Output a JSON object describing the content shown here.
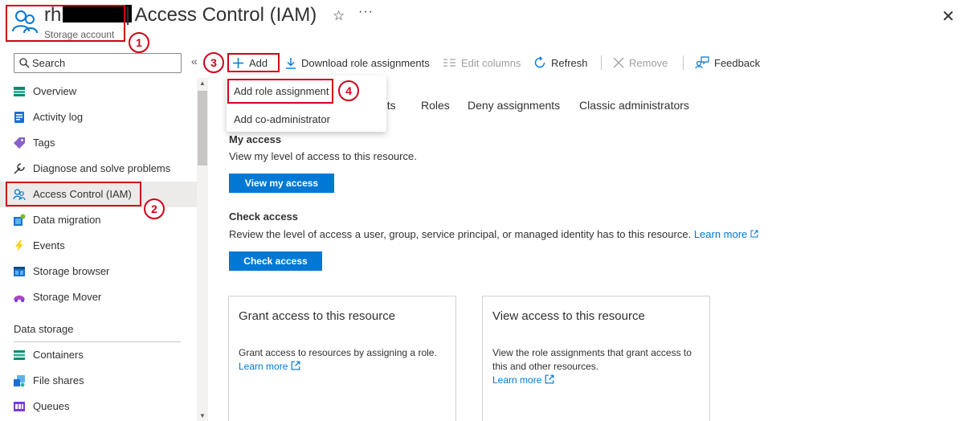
{
  "header": {
    "resource_name_prefix": "rh",
    "resource_type": "Storage account",
    "page_title": "| Access Control (IAM)",
    "favorite_glyph": "☆",
    "more_glyph": "···",
    "close_glyph": "✕"
  },
  "sidebar": {
    "search_placeholder": "Search",
    "collapse_glyph": "«",
    "items": [
      {
        "label": "Overview",
        "icon": "overview-icon"
      },
      {
        "label": "Activity log",
        "icon": "activity-log-icon"
      },
      {
        "label": "Tags",
        "icon": "tag-icon"
      },
      {
        "label": "Diagnose and solve problems",
        "icon": "wrench-icon"
      },
      {
        "label": "Access Control (IAM)",
        "icon": "people-icon",
        "selected": true
      },
      {
        "label": "Data migration",
        "icon": "data-migration-icon"
      },
      {
        "label": "Events",
        "icon": "lightning-icon"
      },
      {
        "label": "Storage browser",
        "icon": "storage-browser-icon"
      },
      {
        "label": "Storage Mover",
        "icon": "storage-mover-icon"
      }
    ],
    "section_title": "Data storage",
    "section_items": [
      {
        "label": "Containers",
        "icon": "containers-icon"
      },
      {
        "label": "File shares",
        "icon": "file-shares-icon"
      },
      {
        "label": "Queues",
        "icon": "queues-icon"
      }
    ]
  },
  "toolbar": {
    "add": "Add",
    "download": "Download role assignments",
    "edit_columns": "Edit columns",
    "refresh": "Refresh",
    "remove": "Remove",
    "feedback": "Feedback"
  },
  "add_menu": {
    "items": [
      "Add role assignment",
      "Add co-administrator"
    ]
  },
  "tabs": [
    "nts",
    "Roles",
    "Deny assignments",
    "Classic administrators"
  ],
  "my_access": {
    "title": "My access",
    "text": "View my level of access to this resource.",
    "button": "View my access"
  },
  "check_access": {
    "title": "Check access",
    "text": "Review the level of access a user, group, service principal, or managed identity has to this resource.",
    "link": "Learn more",
    "button": "Check access"
  },
  "cards": [
    {
      "title": "Grant access to this resource",
      "text": "Grant access to resources by assigning a role.",
      "link": "Learn more"
    },
    {
      "title": "View access to this resource",
      "text": "View the role assignments that grant access to this and other resources.",
      "link": "Learn more"
    }
  ],
  "markers": [
    "1",
    "2",
    "3",
    "4"
  ],
  "colors": {
    "accent": "#0078d4",
    "annotation": "#d0021b",
    "selected_bg": "#edebe9"
  }
}
